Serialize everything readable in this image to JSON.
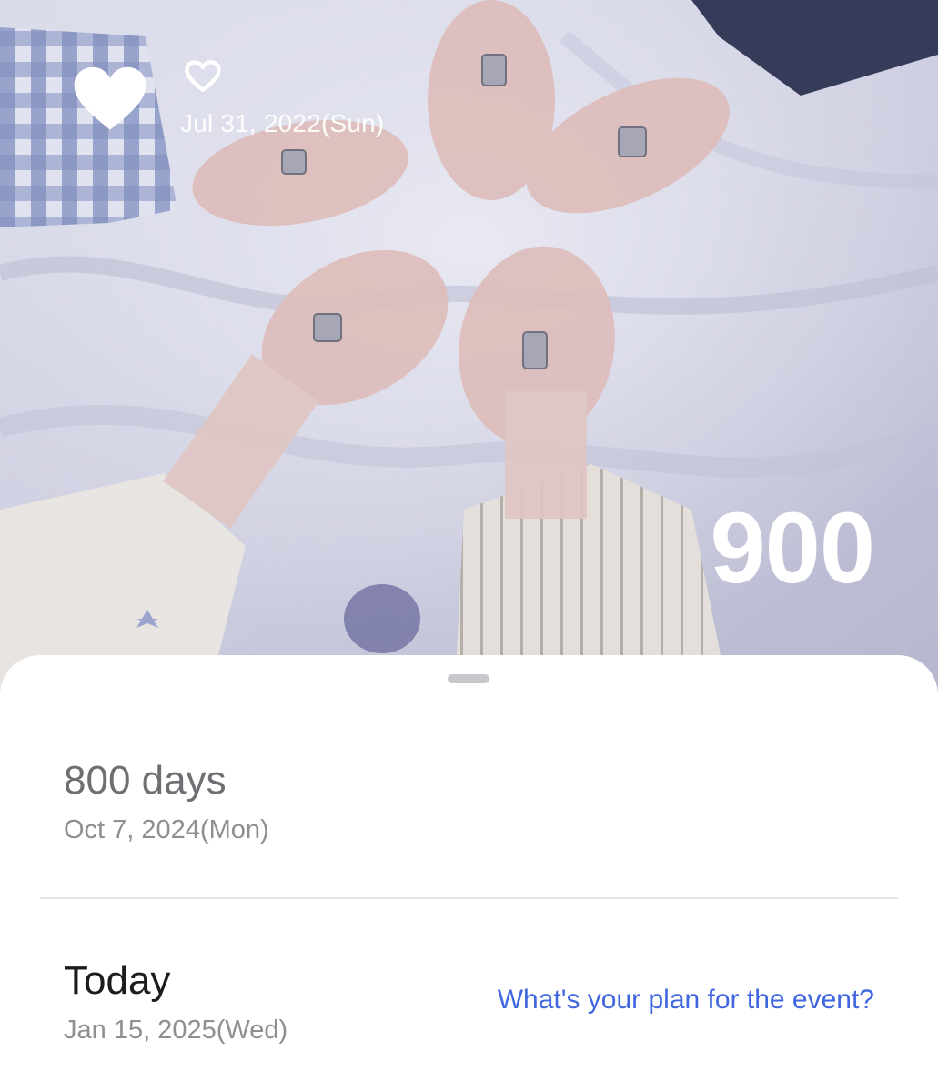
{
  "hero": {
    "photo_description_icon": "photo-icon",
    "start_date": "Jul 31, 2022(Sun)",
    "day_count": "900",
    "favorite_icon": "heart-filled-icon",
    "small_icon": "heart-outline-icon"
  },
  "events": [
    {
      "title": "800 days",
      "date": "Oct 7, 2024(Mon)"
    },
    {
      "title": "Today",
      "date": "Jan 15, 2025(Wed)",
      "action_label": "What's your plan for the event?"
    }
  ],
  "colors": {
    "accent_link": "#3f66e0",
    "muted_text": "#8e8e93",
    "divider": "#e5e5ea"
  }
}
